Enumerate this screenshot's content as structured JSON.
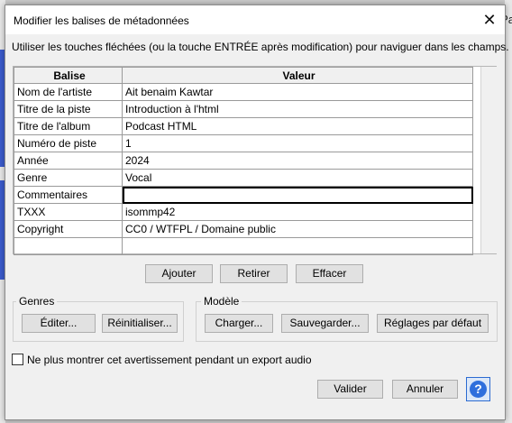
{
  "background": {
    "right_label": "Pa"
  },
  "dialog": {
    "title": "Modifier les balises de métadonnées",
    "close_glyph": "✕",
    "hint": "Utiliser les touches fléchées (ou la touche ENTRÉE après modification) pour naviguer dans les champs.",
    "grid": {
      "headers": [
        "Balise",
        "Valeur"
      ],
      "rows": [
        [
          "Nom de l'artiste",
          "Ait benaim Kawtar"
        ],
        [
          "Titre de la piste",
          "Introduction à l'html"
        ],
        [
          "Titre de l'album",
          "Podcast HTML"
        ],
        [
          "Numéro de piste",
          "1"
        ],
        [
          "Année",
          "2024"
        ],
        [
          "Genre",
          "Vocal"
        ],
        [
          "Commentaires",
          ""
        ],
        [
          "TXXX",
          "isommp42"
        ],
        [
          "Copyright",
          "CC0 / WTFPL / Domaine public"
        ],
        [
          "",
          ""
        ]
      ]
    },
    "row_buttons": {
      "add": "Ajouter",
      "remove": "Retirer",
      "clear": "Effacer"
    },
    "genres": {
      "label": "Genres",
      "edit": "Éditer...",
      "reset": "Réinitialiser..."
    },
    "template": {
      "label": "Modèle",
      "load": "Charger...",
      "save": "Sauvegarder...",
      "defaults": "Réglages par défaut"
    },
    "checkbox_label": "Ne plus montrer cet avertissement pendant un export audio",
    "checkbox_checked": false,
    "ok": "Valider",
    "cancel": "Annuler",
    "help_glyph": "?"
  }
}
